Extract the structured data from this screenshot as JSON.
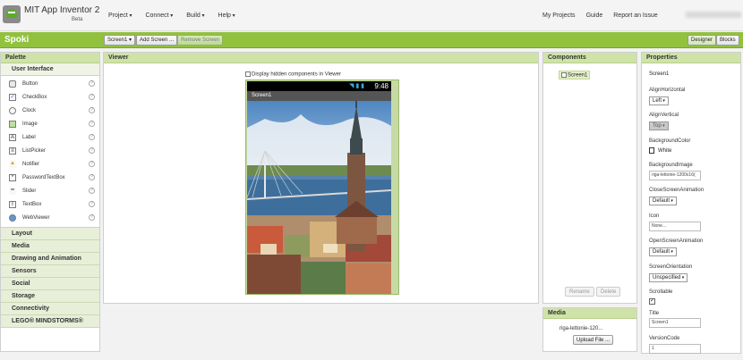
{
  "header": {
    "title": "MIT App Inventor 2",
    "subtitle": "Beta",
    "menus": [
      "Project",
      "Connect",
      "Build",
      "Help"
    ],
    "links": [
      "My Projects",
      "Guide",
      "Report an Issue"
    ]
  },
  "project": {
    "name": "Spoki",
    "screen_select": "Screen1 ▾",
    "add_screen": "Add Screen ...",
    "remove_screen": "Remove Screen",
    "designer": "Designer",
    "blocks": "Blocks"
  },
  "palette": {
    "title": "Palette",
    "open_group": "User Interface",
    "items": [
      {
        "label": "Button",
        "icon": "button-icon"
      },
      {
        "label": "CheckBox",
        "icon": "checkbox-icon"
      },
      {
        "label": "Clock",
        "icon": "clock-icon"
      },
      {
        "label": "Image",
        "icon": "image-icon"
      },
      {
        "label": "Label",
        "icon": "label-icon"
      },
      {
        "label": "ListPicker",
        "icon": "listpicker-icon"
      },
      {
        "label": "Notifier",
        "icon": "notifier-icon"
      },
      {
        "label": "PasswordTextBox",
        "icon": "password-icon"
      },
      {
        "label": "Slider",
        "icon": "slider-icon"
      },
      {
        "label": "TextBox",
        "icon": "textbox-icon"
      },
      {
        "label": "WebViewer",
        "icon": "webviewer-icon"
      }
    ],
    "groups": [
      "Layout",
      "Media",
      "Drawing and Animation",
      "Sensors",
      "Social",
      "Storage",
      "Connectivity",
      "LEGO® MINDSTORMS®"
    ],
    "help": "?"
  },
  "viewer": {
    "title": "Viewer",
    "hidden_components": "Display hidden components in Viewer",
    "time": "9:48",
    "screen_title": "Screen1"
  },
  "components": {
    "title": "Components",
    "tree_item": "Screen1",
    "rename": "Rename",
    "delete": "Delete"
  },
  "media": {
    "title": "Media",
    "file": "riga-lettonie-120...",
    "upload": "Upload File ..."
  },
  "properties": {
    "title": "Properties",
    "screen": "Screen1",
    "align_horizontal_label": "AlignHorizontal",
    "align_horizontal": "Left",
    "align_vertical_label": "AlignVertical",
    "align_vertical": "Top",
    "bg_color_label": "BackgroundColor",
    "bg_color": "White",
    "bg_image_label": "BackgroundImage",
    "bg_image": "riga-lettonie-1200x16(",
    "close_anim_label": "CloseScreenAnimation",
    "close_anim": "Default",
    "icon_label": "Icon",
    "icon_value": "None...",
    "open_anim_label": "OpenScreenAnimation",
    "open_anim": "Default",
    "orientation_label": "ScreenOrientation",
    "orientation": "Unspecified",
    "scrollable_label": "Scrollable",
    "title_label": "Title",
    "title_value": "Screen1",
    "version_code_label": "VersionCode",
    "version_code": "1"
  },
  "colors": {
    "accent": "#92c13e",
    "panel_head": "#cfe3a8"
  }
}
